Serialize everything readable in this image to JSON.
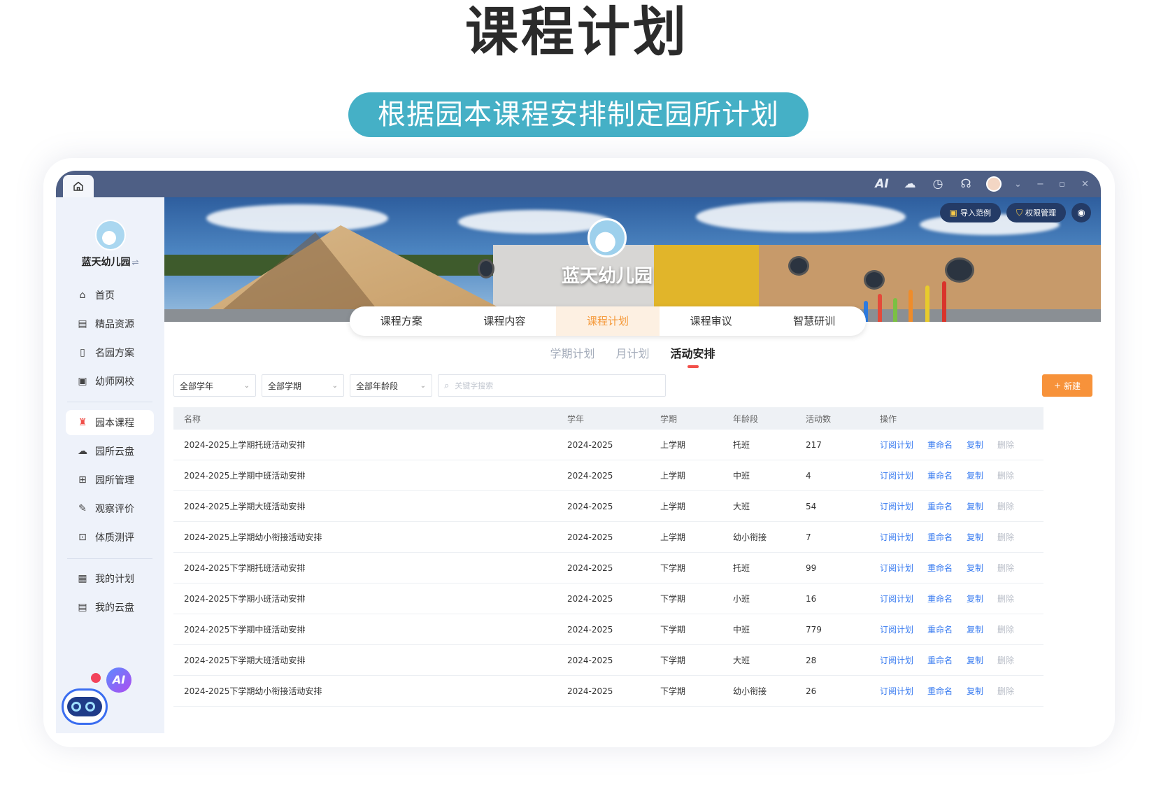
{
  "hero": {
    "title": "课程计划",
    "subtitle": "根据园本课程安排制定园所计划"
  },
  "titlebar": {
    "home_icon": "home-icon",
    "ai_label": "AI",
    "icons": [
      "ai-icon",
      "cloud-icon",
      "history-icon",
      "headset-icon",
      "avatar",
      "chevron-down-icon",
      "minimize-icon",
      "maximize-icon",
      "close-icon"
    ]
  },
  "sidebar": {
    "org_name": "蓝天幼儿园",
    "swap_symbol": "⇌",
    "items": [
      {
        "label": "首页",
        "icon": "home-icon"
      },
      {
        "label": "精品资源",
        "icon": "calendar-icon"
      },
      {
        "label": "名园方案",
        "icon": "bookmark-icon"
      },
      {
        "label": "幼师网校",
        "icon": "book-icon"
      },
      {
        "label": "园本课程",
        "icon": "school-icon"
      },
      {
        "label": "园所云盘",
        "icon": "cloud-icon"
      },
      {
        "label": "园所管理",
        "icon": "grid-icon"
      },
      {
        "label": "观察评价",
        "icon": "edit-doc-icon"
      },
      {
        "label": "体质测评",
        "icon": "fitness-icon"
      },
      {
        "label": "我的计划",
        "icon": "planner-icon"
      },
      {
        "label": "我的云盘",
        "icon": "disk-icon"
      }
    ],
    "active_index": 4,
    "assistant_badge": "AI"
  },
  "banner": {
    "org_name": "蓝天幼儿园",
    "import_label": "导入范例",
    "permission_label": "权限管理"
  },
  "main_tabs": [
    "课程方案",
    "课程内容",
    "课程计划",
    "课程审议",
    "智慧研训"
  ],
  "main_tab_active": 2,
  "sub_tabs": [
    "学期计划",
    "月计划",
    "活动安排"
  ],
  "sub_tab_active": 2,
  "filters": {
    "year": "全部学年",
    "term": "全部学期",
    "age": "全部年龄段",
    "search_placeholder": "关键字搜索",
    "new_label": "新建",
    "new_icon": "+"
  },
  "table": {
    "headers": [
      "名称",
      "学年",
      "学期",
      "年龄段",
      "活动数",
      "操作"
    ],
    "actions": [
      "订阅计划",
      "重命名",
      "复制",
      "删除"
    ],
    "rows": [
      {
        "name": "2024-2025上学期托班活动安排",
        "year": "2024-2025",
        "term": "上学期",
        "age": "托班",
        "count": "217"
      },
      {
        "name": "2024-2025上学期中班活动安排",
        "year": "2024-2025",
        "term": "上学期",
        "age": "中班",
        "count": "4"
      },
      {
        "name": "2024-2025上学期大班活动安排",
        "year": "2024-2025",
        "term": "上学期",
        "age": "大班",
        "count": "54"
      },
      {
        "name": "2024-2025上学期幼小衔接活动安排",
        "year": "2024-2025",
        "term": "上学期",
        "age": "幼小衔接",
        "count": "7"
      },
      {
        "name": "2024-2025下学期托班活动安排",
        "year": "2024-2025",
        "term": "下学期",
        "age": "托班",
        "count": "99"
      },
      {
        "name": "2024-2025下学期小班活动安排",
        "year": "2024-2025",
        "term": "下学期",
        "age": "小班",
        "count": "16"
      },
      {
        "name": "2024-2025下学期中班活动安排",
        "year": "2024-2025",
        "term": "下学期",
        "age": "中班",
        "count": "779"
      },
      {
        "name": "2024-2025下学期大班活动安排",
        "year": "2024-2025",
        "term": "下学期",
        "age": "大班",
        "count": "28"
      },
      {
        "name": "2024-2025下学期幼小衔接活动安排",
        "year": "2024-2025",
        "term": "下学期",
        "age": "幼小衔接",
        "count": "26"
      }
    ]
  },
  "colors": {
    "accent_orange": "#f7923a",
    "link_blue": "#3a7cf0",
    "pill_teal": "#45b0c6",
    "titlebar": "#4e5f85"
  }
}
